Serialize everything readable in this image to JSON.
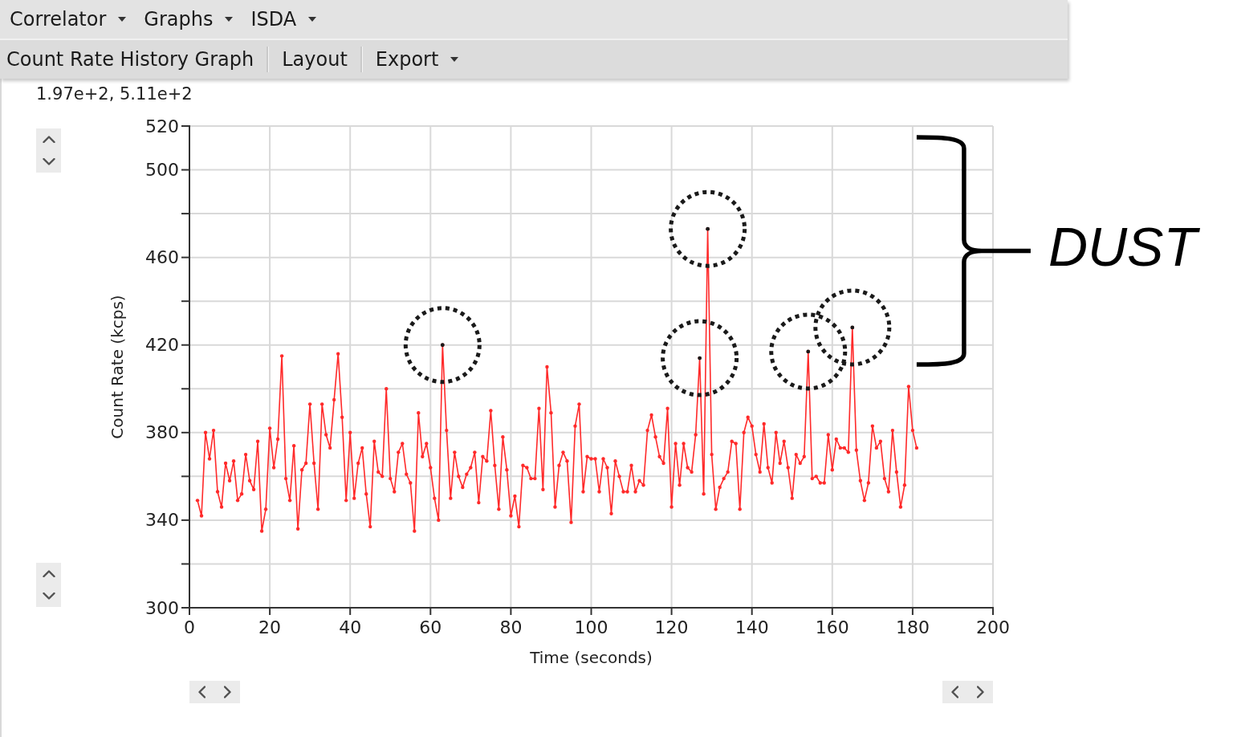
{
  "menu_bar": {
    "menus": [
      "Correlator",
      "Graphs",
      "ISDA"
    ]
  },
  "toolbar": {
    "items": [
      {
        "label": "Count Rate History Graph",
        "kind": "button"
      },
      {
        "label": "Layout",
        "kind": "button"
      },
      {
        "label": "Export",
        "kind": "dropdown"
      }
    ]
  },
  "cursor_readout": "1.97e+2, 5.11e+2",
  "graph": {
    "chart_data": {
      "type": "line",
      "grid": true,
      "xlabel": "Time (seconds)",
      "ylabel": "Count Rate (kcps)",
      "xlim": [
        0,
        200
      ],
      "ylim": [
        300,
        520
      ],
      "xticks": [
        0,
        20,
        40,
        60,
        80,
        100,
        120,
        140,
        160,
        180,
        200
      ],
      "yticks": [
        300,
        340,
        380,
        420,
        460,
        500,
        520
      ],
      "x": [
        2,
        3,
        4,
        5,
        6,
        7,
        8,
        9,
        10,
        11,
        12,
        13,
        14,
        15,
        16,
        17,
        18,
        19,
        20,
        21,
        22,
        23,
        24,
        25,
        26,
        27,
        28,
        29,
        30,
        31,
        32,
        33,
        34,
        35,
        36,
        37,
        38,
        39,
        40,
        41,
        42,
        43,
        44,
        45,
        46,
        47,
        48,
        49,
        50,
        51,
        52,
        53,
        54,
        55,
        56,
        57,
        58,
        59,
        60,
        61,
        62,
        63,
        64,
        65,
        66,
        67,
        68,
        69,
        70,
        71,
        72,
        73,
        74,
        75,
        76,
        77,
        78,
        79,
        80,
        81,
        82,
        83,
        84,
        85,
        86,
        87,
        88,
        89,
        90,
        91,
        92,
        93,
        94,
        95,
        96,
        97,
        98,
        99,
        100,
        101,
        102,
        103,
        104,
        105,
        106,
        107,
        108,
        109,
        110,
        111,
        112,
        113,
        114,
        115,
        116,
        117,
        118,
        119,
        120,
        121,
        122,
        123,
        124,
        125,
        126,
        127,
        128,
        129,
        130,
        131,
        132,
        133,
        134,
        135,
        136,
        137,
        138,
        139,
        140,
        141,
        142,
        143,
        144,
        145,
        146,
        147,
        148,
        149,
        150,
        151,
        152,
        153,
        154,
        155,
        156,
        157,
        158,
        159,
        160,
        161,
        162,
        163,
        164,
        165,
        166,
        167,
        168,
        169,
        170,
        171,
        172,
        173,
        174,
        175,
        176,
        177,
        178,
        179,
        180,
        181
      ],
      "series": [
        {
          "color": "#ff2a2a",
          "values": [
            349,
            342,
            380,
            368,
            381,
            353,
            346,
            366,
            358,
            367,
            349,
            352,
            370,
            358,
            354,
            376,
            335,
            345,
            382,
            364,
            377,
            415,
            359,
            349,
            374,
            336,
            363,
            366,
            393,
            366,
            345,
            393,
            379,
            373,
            395,
            416,
            387,
            349,
            380,
            350,
            366,
            373,
            352,
            337,
            376,
            362,
            360,
            400,
            359,
            353,
            371,
            375,
            361,
            357,
            335,
            389,
            369,
            375,
            364,
            350,
            340,
            420,
            381,
            350,
            371,
            360,
            355,
            361,
            364,
            371,
            348,
            369,
            367,
            390,
            365,
            345,
            378,
            363,
            342,
            351,
            337,
            365,
            364,
            359,
            359,
            391,
            354,
            410,
            389,
            346,
            365,
            371,
            367,
            339,
            383,
            393,
            353,
            369,
            368,
            368,
            353,
            368,
            364,
            343,
            367,
            360,
            353,
            353,
            365,
            353,
            358,
            356,
            381,
            388,
            378,
            369,
            366,
            391,
            346,
            375,
            356,
            375,
            364,
            362,
            379,
            414,
            352,
            473,
            370,
            345,
            355,
            359,
            362,
            376,
            375,
            345,
            380,
            387,
            383,
            370,
            362,
            384,
            364,
            357,
            380,
            366,
            376,
            364,
            350,
            370,
            366,
            369,
            417,
            359,
            360,
            357,
            357,
            379,
            363,
            377,
            373,
            373,
            371,
            428,
            372,
            358,
            349,
            357,
            383,
            373,
            376,
            359,
            353,
            381,
            362,
            346,
            356,
            401,
            381,
            373
          ]
        },
        {
          "type": "scatter",
          "color": "#1a1a1a",
          "values": [
            null,
            null,
            null,
            null,
            null,
            null,
            null,
            null,
            null,
            null,
            null,
            null,
            null,
            null,
            null,
            null,
            null,
            null,
            null,
            null,
            null,
            null,
            null,
            null,
            null,
            null,
            null,
            null,
            null,
            null,
            null,
            null,
            null,
            null,
            null,
            null,
            null,
            null,
            null,
            null,
            null,
            null,
            null,
            null,
            null,
            null,
            null,
            null,
            null,
            null,
            null,
            null,
            null,
            null,
            null,
            null,
            null,
            null,
            null,
            null,
            null,
            420,
            null,
            null,
            null,
            null,
            null,
            null,
            null,
            null,
            null,
            null,
            null,
            null,
            null,
            null,
            null,
            null,
            null,
            null,
            null,
            null,
            null,
            null,
            null,
            null,
            null,
            null,
            null,
            null,
            null,
            null,
            null,
            null,
            null,
            null,
            null,
            null,
            null,
            null,
            null,
            null,
            null,
            null,
            null,
            null,
            null,
            null,
            null,
            null,
            null,
            null,
            null,
            null,
            null,
            null,
            null,
            null,
            null,
            null,
            null,
            null,
            null,
            null,
            null,
            414,
            null,
            473,
            null,
            null,
            null,
            null,
            null,
            null,
            null,
            null,
            null,
            null,
            null,
            null,
            null,
            null,
            null,
            null,
            null,
            null,
            null,
            null,
            null,
            null,
            null,
            null,
            417,
            null,
            null,
            null,
            null,
            null,
            null,
            null,
            null,
            null,
            null,
            428,
            null,
            null,
            null,
            null,
            null,
            null,
            null,
            null,
            null,
            null,
            null,
            null,
            null,
            null,
            null,
            null
          ]
        }
      ],
      "annotations": [
        {
          "text": "DUST"
        }
      ]
    }
  }
}
